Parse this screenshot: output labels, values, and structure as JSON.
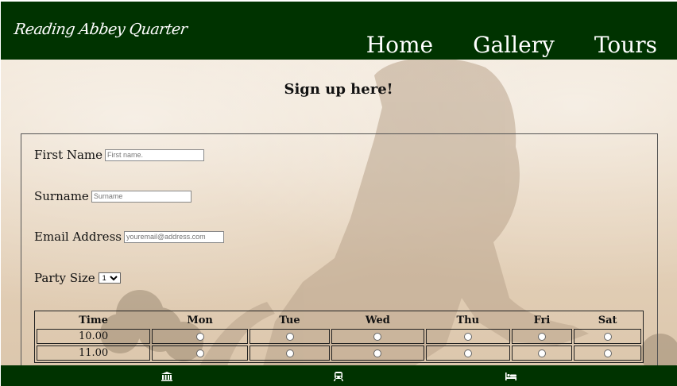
{
  "header": {
    "logo": "Reading Abbey Quarter",
    "nav": [
      "Home",
      "Gallery",
      "Tours"
    ]
  },
  "main": {
    "title": "Sign up here!",
    "form": {
      "first_name_label": "First Name",
      "first_name_placeholder": "First name.",
      "surname_label": "Surname",
      "surname_placeholder": "Surname",
      "email_label": "Email Address",
      "email_placeholder": "youremail@address.com",
      "party_label": "Party Size",
      "party_value": "1"
    },
    "table": {
      "headers": [
        "Time",
        "Mon",
        "Tue",
        "Wed",
        "Thu",
        "Fri",
        "Sat"
      ],
      "rows": [
        "10.00",
        "11.00"
      ]
    }
  },
  "footer": {
    "icons": [
      "museum-icon",
      "train-icon",
      "bed-icon"
    ]
  },
  "colors": {
    "header_bg": "#003300",
    "footer_bg": "#003300"
  }
}
